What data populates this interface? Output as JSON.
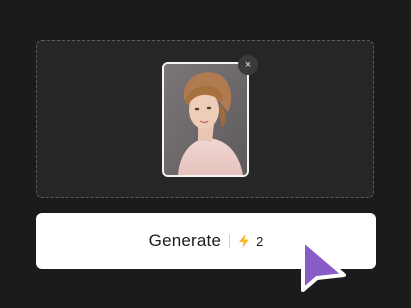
{
  "upload": {
    "remove_icon": "×"
  },
  "generate_button": {
    "label": "Generate",
    "credit_icon": "lightning-bolt-icon",
    "credit_count": "2"
  },
  "colors": {
    "background": "#1b1b1b",
    "upload_zone": "#262626",
    "button_bg": "#ffffff",
    "bolt": "#f5b82e",
    "cursor": "#8a5cc8"
  }
}
